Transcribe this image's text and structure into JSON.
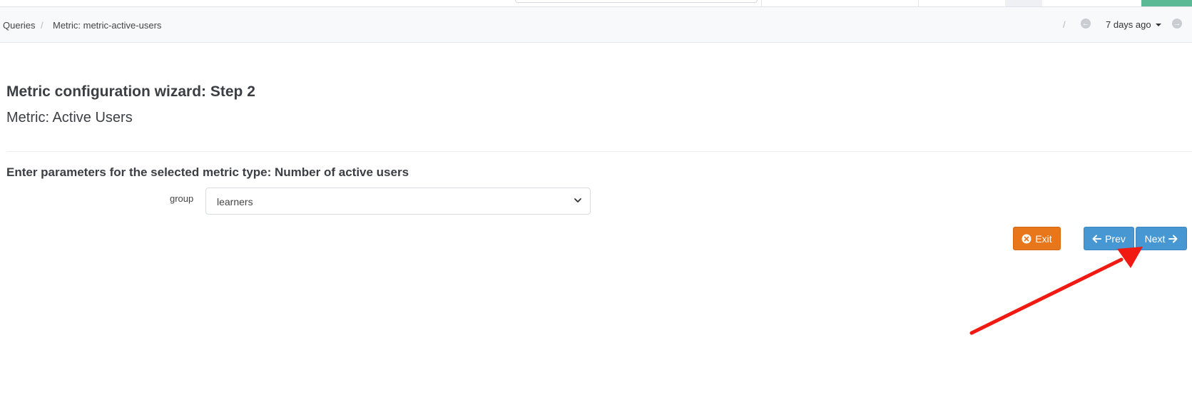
{
  "breadcrumb": {
    "items": [
      "Queries",
      "Metric: metric-active-users"
    ],
    "separator": "/"
  },
  "time_nav": {
    "separator": "/",
    "prev_icon": "circle-arrow-left-icon",
    "next_icon": "circle-arrow-right-icon",
    "range_label": "7 days ago"
  },
  "wizard": {
    "title": "Metric configuration wizard: Step 2",
    "subtitle": "Metric: Active Users",
    "section_heading": "Enter parameters for the selected metric type: Number of active users",
    "group_field": {
      "label": "group",
      "selected": "learners"
    }
  },
  "buttons": {
    "exit": "Exit",
    "prev": "Prev",
    "next": "Next"
  },
  "colors": {
    "exit_button": "#e8761a",
    "nav_button": "#4797d3",
    "annotation_arrow": "#f01a12",
    "top_accent": "#5cb996"
  }
}
